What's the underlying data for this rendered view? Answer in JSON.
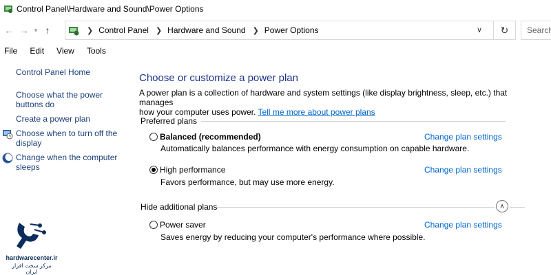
{
  "window": {
    "title": "Control Panel\\Hardware and Sound\\Power Options"
  },
  "address": {
    "breadcrumbs": [
      "Control Panel",
      "Hardware and Sound",
      "Power Options"
    ],
    "search_placeholder": "Search"
  },
  "menu": [
    "File",
    "Edit",
    "View",
    "Tools"
  ],
  "sidebar": {
    "home": "Control Panel Home",
    "links": [
      {
        "line1": "Choose what the power",
        "line2": "buttons do",
        "icon": ""
      },
      {
        "line1": "Create a power plan",
        "line2": "",
        "icon": ""
      },
      {
        "line1": "Choose when to turn off the",
        "line2": "display",
        "icon": "monitor-clock-icon"
      },
      {
        "line1": "Change when the computer",
        "line2": "sleeps",
        "icon": "moon-icon"
      }
    ]
  },
  "main": {
    "title": "Choose or customize a power plan",
    "intro_line1": "A power plan is a collection of hardware and system settings (like display brightness, sleep, etc.) that manages",
    "intro_line2": "how your computer uses power.",
    "intro_link": "Tell me more about power plans",
    "preferred_heading": "Preferred plans",
    "hidden_heading": "Hide additional plans",
    "plans": [
      {
        "name": "Balanced (recommended)",
        "desc": "Automatically balances performance with energy consumption on capable hardware.",
        "selected": false,
        "link": "Change plan settings"
      },
      {
        "name": "High performance",
        "desc": "Favors performance, but may use more energy.",
        "selected": true,
        "link": "Change plan settings"
      },
      {
        "name": "Power saver",
        "desc": "Saves energy by reducing your computer's performance where possible.",
        "selected": false,
        "link": "Change plan settings"
      }
    ]
  },
  "watermark": {
    "brand": "hardwarecenter.ir",
    "subtitle": "مرکز سخت افزار ایران"
  },
  "colors": {
    "link": "#0066cc",
    "title": "#1e3287",
    "sidebar_link": "#1a3f7a",
    "watermark": "#0c2d5c"
  }
}
